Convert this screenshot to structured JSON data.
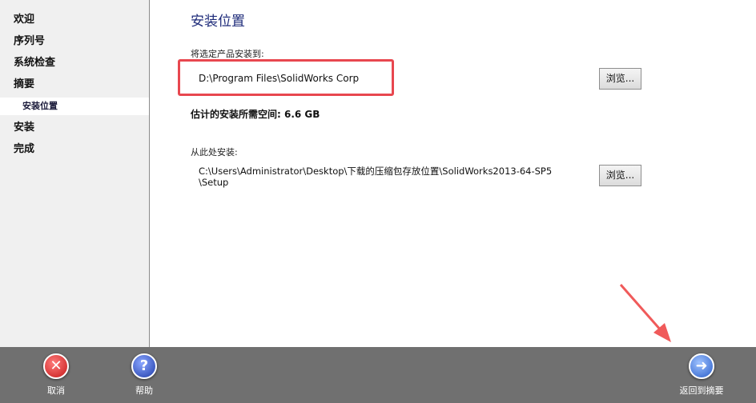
{
  "sidebar": {
    "items": [
      {
        "label": "欢迎"
      },
      {
        "label": "序列号"
      },
      {
        "label": "系统检查"
      },
      {
        "label": "摘要"
      },
      {
        "label": "安装位置"
      },
      {
        "label": "安装"
      },
      {
        "label": "完成"
      }
    ]
  },
  "main": {
    "title": "安装位置",
    "install_to_label": "将选定产品安装到:",
    "install_path": "D:\\Program Files\\SolidWorks Corp",
    "browse_label": "浏览...",
    "space_text": "估计的安装所需空间: 6.6 GB",
    "install_from_label": "从此处安装:",
    "source_path_line1": "C:\\Users\\Administrator\\Desktop\\下载的压缩包存放位置\\SolidWorks2013-64-SP5",
    "source_path_line2": "\\Setup"
  },
  "bottom_bar": {
    "cancel_label": "取消",
    "help_label": "帮助",
    "back_to_summary_label": "返回到摘要"
  },
  "colors": {
    "highlight_box": "#e8474f",
    "annotation_arrow": "#f05a5a",
    "title": "#1e2b7a"
  },
  "icons": {
    "cancel": "close-circle-icon",
    "help": "question-circle-icon",
    "back": "arrow-right-circle-icon"
  }
}
